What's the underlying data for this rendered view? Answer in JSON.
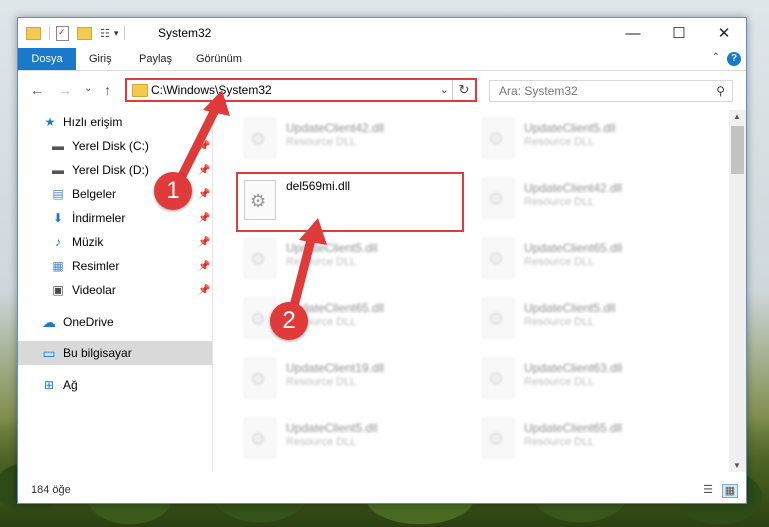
{
  "window": {
    "title": "System32",
    "minimize_glyph": "—",
    "maximize_glyph": "☐",
    "close_glyph": "✕"
  },
  "ribbon": {
    "tabs": [
      "Dosya",
      "Giriş",
      "Paylaş",
      "Görünüm"
    ],
    "help_glyph": "?",
    "collapse_glyph": "⌃"
  },
  "navigation": {
    "back_glyph": "←",
    "forward_glyph": "→",
    "recent_glyph": "⌄",
    "up_glyph": "↑",
    "address_path": "C:\\Windows\\System32",
    "address_dropdown_glyph": "⌄",
    "refresh_glyph": "↻",
    "search_placeholder": "Ara: System32",
    "search_glyph": "⚲"
  },
  "sidebar": {
    "items": [
      {
        "label": "Hızlı erişim",
        "icon": "star-icon",
        "glyph": "★",
        "color": "#1979ca",
        "pinned": false
      },
      {
        "label": "Yerel Disk (C:)",
        "icon": "drive-icon",
        "glyph": "▬",
        "color": "#555555",
        "pinned": true
      },
      {
        "label": "Yerel Disk (D:)",
        "icon": "drive-icon",
        "glyph": "▬",
        "color": "#555555",
        "pinned": true
      },
      {
        "label": "Belgeler",
        "icon": "documents-icon",
        "glyph": "▤",
        "color": "#4a86c8",
        "pinned": true
      },
      {
        "label": "İndirmeler",
        "icon": "download-icon",
        "glyph": "⬇",
        "color": "#1979ca",
        "pinned": true
      },
      {
        "label": "Müzik",
        "icon": "music-icon",
        "glyph": "♪",
        "color": "#1979ca",
        "pinned": true
      },
      {
        "label": "Resimler",
        "icon": "pictures-icon",
        "glyph": "▦",
        "color": "#4a86c8",
        "pinned": true
      },
      {
        "label": "Videolar",
        "icon": "videos-icon",
        "glyph": "▣",
        "color": "#4a4a4a",
        "pinned": true
      },
      {
        "label": "OneDrive",
        "icon": "cloud-icon",
        "glyph": "☁",
        "color": "#1979ca",
        "pinned": false
      },
      {
        "label": "Bu bilgisayar",
        "icon": "computer-icon",
        "glyph": "▭",
        "color": "#1979ca",
        "pinned": false,
        "selected": true
      },
      {
        "label": "Ağ",
        "icon": "network-icon",
        "glyph": "⊞",
        "color": "#1979ca",
        "pinned": false
      }
    ],
    "pin_glyph": "📌"
  },
  "files": {
    "left_column": [
      {
        "name": "UpdateClient42.dll",
        "type": "Resource DLL"
      },
      {
        "name": "UpdateClient5.dll",
        "type": "Resource DLL"
      },
      {
        "name": "UpdateClient65.dll",
        "type": "Resource DLL"
      },
      {
        "name": "UpdateClient19.dll",
        "type": "Resource DLL"
      },
      {
        "name": "UpdateClient5.dll",
        "type": "Resource DLL"
      }
    ],
    "right_column": [
      {
        "name": "UpdateClient5.dll",
        "type": "Resource DLL"
      },
      {
        "name": "UpdateClient42.dll",
        "type": "Resource DLL"
      },
      {
        "name": "UpdateClient65.dll",
        "type": "Resource DLL"
      },
      {
        "name": "UpdateClient5.dll",
        "type": "Resource DLL"
      },
      {
        "name": "UpdateClient63.dll",
        "type": "Resource DLL"
      },
      {
        "name": "UpdateClient65.dll",
        "type": "Resource DLL"
      }
    ],
    "highlighted": {
      "name": "del569mi.dll"
    }
  },
  "status": {
    "item_count": "184 öğe",
    "details_view_glyph": "☰",
    "large_icons_glyph": "▦"
  },
  "callouts": {
    "step1": "1",
    "step2": "2",
    "color": "#e03a3a"
  }
}
